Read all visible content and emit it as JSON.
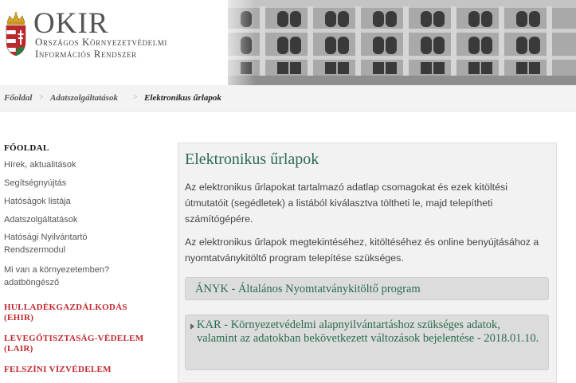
{
  "header": {
    "logo_title": "OKIR",
    "logo_line1": "Országos Környezetvédelmi",
    "logo_line2": "Információs Rendszer"
  },
  "breadcrumb": {
    "items": [
      "Főoldal",
      "Adatszolgáltatások",
      "Elektronikus űrlapok"
    ],
    "separator": ">"
  },
  "sidebar": {
    "title": "FŐOLDAL",
    "links": [
      "Hírek, aktualitások",
      "Segítségnyújtás",
      "Hatóságok listája",
      "Adatszolgáltatások",
      "Hatósági Nyilvántartó Rendszermodul",
      "Mi van a környezetemben? adatböngésző"
    ],
    "sections": [
      "HULLADÉKGAZDÁLKODÁS (EHIR)",
      "LEVEGŐTISZTASÁG-VÉDELEM (LAIR)",
      "FELSZÍNI VÍZVÉDELEM"
    ]
  },
  "content": {
    "title": "Elektronikus űrlapok",
    "paragraph1": "Az elektronikus űrlapokat tartalmazó adatlap csomagokat és ezek kitöltési útmutatóit (segédletek) a listából kiválasztva töltheti le, majd telepítheti számítógépére.",
    "paragraph2": "Az elektronikus űrlapok megtekintéséhez, kitöltéséhez és online benyújtásához a nyomtatványkitöltő program telepítése szükséges.",
    "accordion": [
      "ÁNYK - Általános Nyomtatványkitöltő program",
      "KAR - Környezetvédelmi alapnyilvántartáshoz szükséges adatok, valamint az adatokban bekövetkezett változások bejelentése - 2018.01.10."
    ]
  },
  "colors": {
    "accent_green": "#2a6b4f",
    "section_red": "#c0272d"
  }
}
